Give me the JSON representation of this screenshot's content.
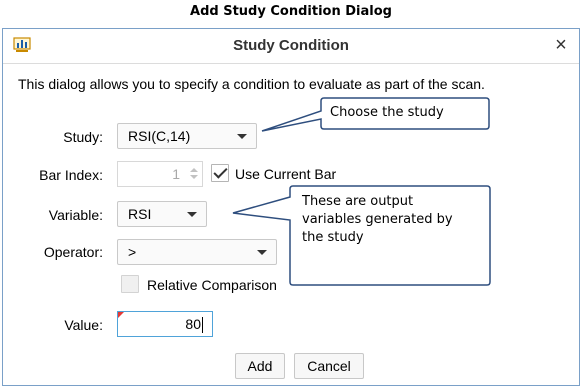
{
  "caption": "Add Study Condition Dialog",
  "dialog": {
    "title": "Study Condition",
    "close_symbol": "×",
    "icon": "chart-app-icon",
    "description": "This dialog allows you to specify a condition to evaluate as part of the scan."
  },
  "fields": {
    "study_label": "Study:",
    "study_value": "RSI(C,14)",
    "bar_index_label": "Bar Index:",
    "bar_index_value": "1",
    "use_current_bar_label": "Use Current Bar",
    "use_current_bar_checked": true,
    "variable_label": "Variable:",
    "variable_value": "RSI",
    "operator_label": "Operator:",
    "operator_value": ">",
    "relative_comparison_label": "Relative Comparison",
    "relative_comparison_checked": false,
    "value_label": "Value:",
    "value_value": "80"
  },
  "buttons": {
    "add": "Add",
    "cancel": "Cancel"
  },
  "callouts": {
    "study": "Choose the study",
    "variable": "These are output variables generated by the study"
  },
  "colors": {
    "callout_border": "#2e4e7e",
    "dialog_border": "#7aa0c8",
    "focus_border": "#4fa3d9",
    "error_marker": "#e53935"
  }
}
